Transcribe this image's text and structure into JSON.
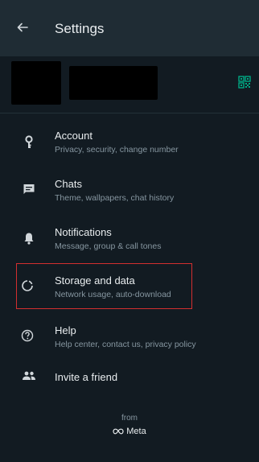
{
  "header": {
    "title": "Settings"
  },
  "items": [
    {
      "label": "Account",
      "sub": "Privacy, security, change number",
      "icon": "key-icon"
    },
    {
      "label": "Chats",
      "sub": "Theme, wallpapers, chat history",
      "icon": "chat-icon"
    },
    {
      "label": "Notifications",
      "sub": "Message, group & call tones",
      "icon": "bell-icon"
    },
    {
      "label": "Storage and data",
      "sub": "Network usage, auto-download",
      "icon": "storage-icon"
    },
    {
      "label": "Help",
      "sub": "Help center, contact us, privacy policy",
      "icon": "help-icon"
    },
    {
      "label": "Invite a friend",
      "sub": "",
      "icon": "people-icon"
    }
  ],
  "footer": {
    "from": "from",
    "brand": "Meta"
  },
  "colors": {
    "background": "#121b22",
    "appbar": "#1f2c34",
    "accent_qr": "#00a884",
    "highlight": "#d32f2f"
  }
}
